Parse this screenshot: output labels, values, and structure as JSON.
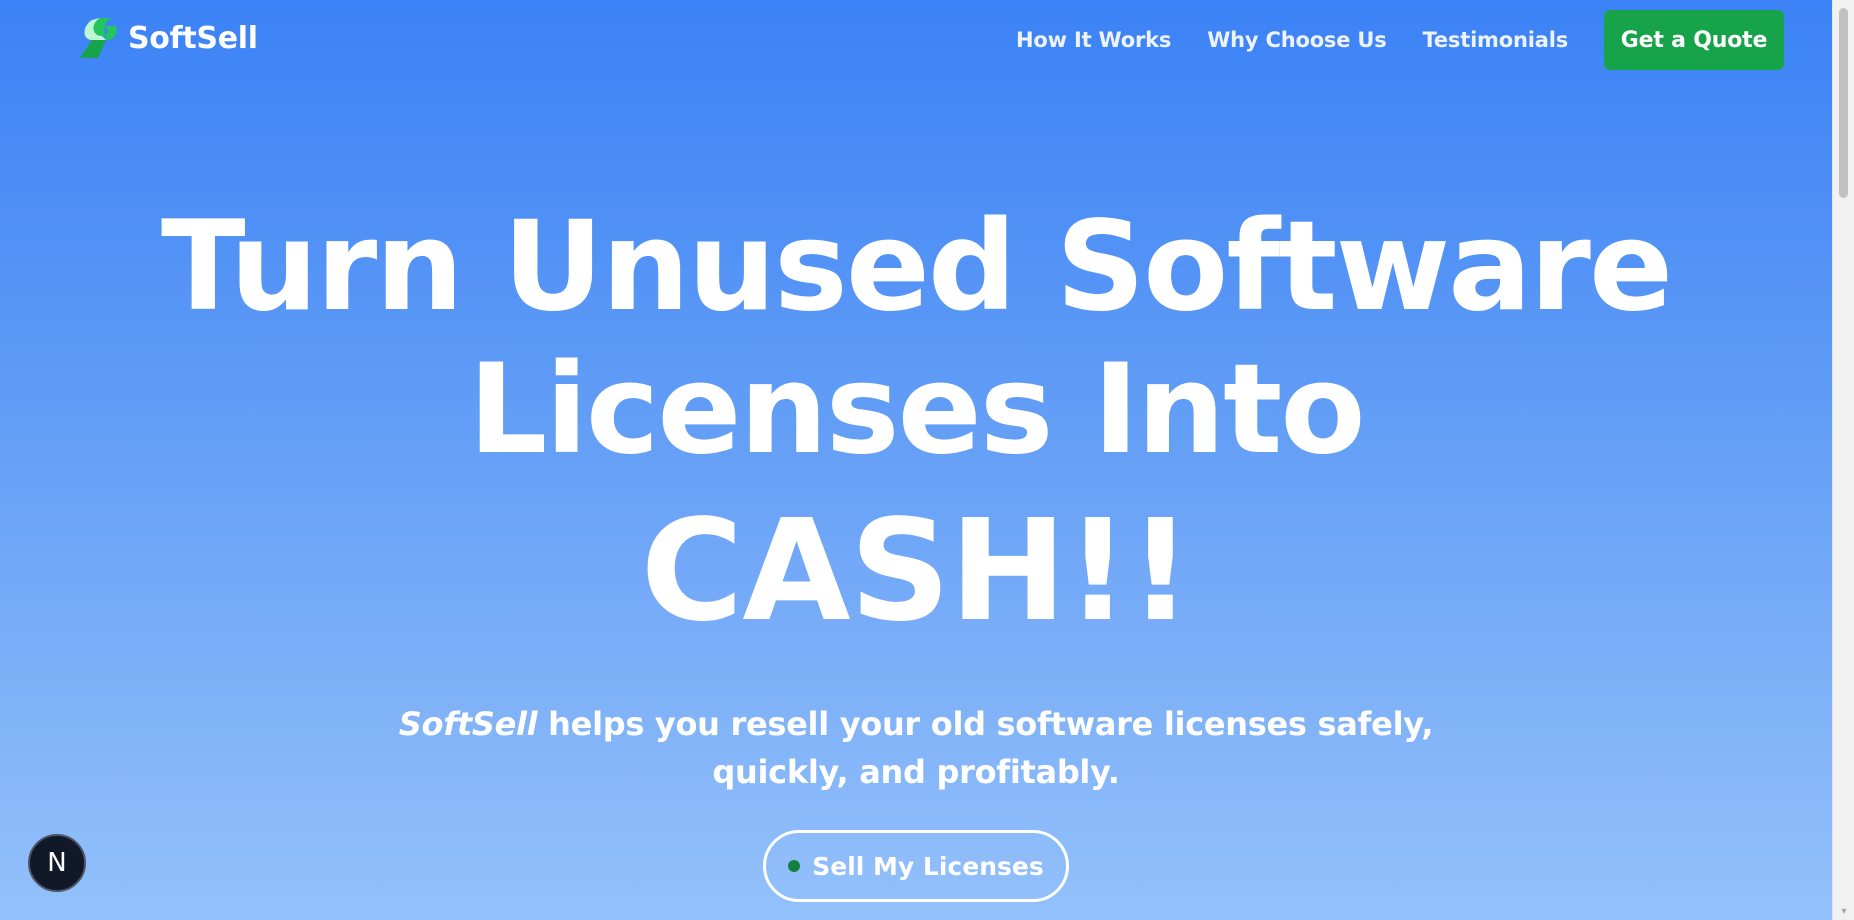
{
  "brand": {
    "name": "SoftSell",
    "logo_icon": "softsell-leaf-logo",
    "logo_colors": {
      "primary": "#22c55e",
      "secondary": "#16a34a",
      "highlight": "#bbf7d0"
    }
  },
  "nav": {
    "links": [
      "How It Works",
      "Why Choose Us",
      "Testimonials"
    ],
    "quote_button": "Get a Quote"
  },
  "hero": {
    "headline_line1": "Turn Unused Software",
    "headline_line2": "Licenses Into",
    "headline_line3": "CASH!!",
    "subtitle_brand": "SoftSell",
    "subtitle_part1": " helps you resell your old software licenses safely,",
    "subtitle_part2": "quickly, and profitably.",
    "cta_label": "Sell My Licenses"
  },
  "dev_badge": {
    "letter": "N"
  },
  "colors": {
    "gradient_top": "#3b82f6",
    "gradient_bottom": "#93c1fb",
    "accent_green": "#16a34a",
    "text": "#ffffff"
  }
}
